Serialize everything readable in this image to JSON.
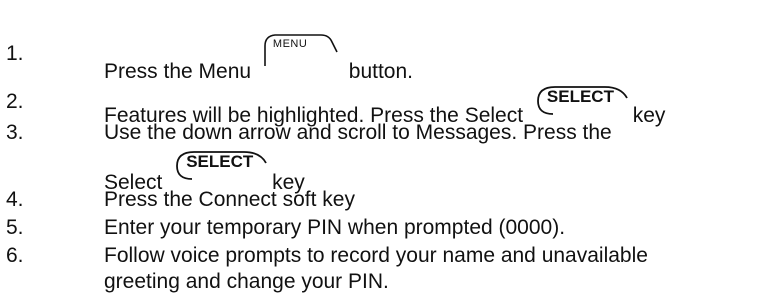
{
  "steps": [
    {
      "number": "1.",
      "text_before": "Press the Menu",
      "key_label": "MENU",
      "text_after": "button."
    },
    {
      "number": "2.",
      "text_before": "Features will be highlighted.  Press the Select",
      "key_label": "SELECT",
      "text_after": "key"
    },
    {
      "number": "3.",
      "text_line1": "Use the down arrow and scroll to Messages.  Press the",
      "text_before": "Select",
      "key_label": "SELECT",
      "text_after": "key"
    },
    {
      "number": "4.",
      "text": "Press the Connect soft key"
    },
    {
      "number": "5.",
      "text": "Enter your temporary PIN when prompted (0000)."
    },
    {
      "number": "6.",
      "text_line1": "Follow voice prompts to record your name and unavailable",
      "text_line2": "greeting and change your PIN."
    }
  ]
}
